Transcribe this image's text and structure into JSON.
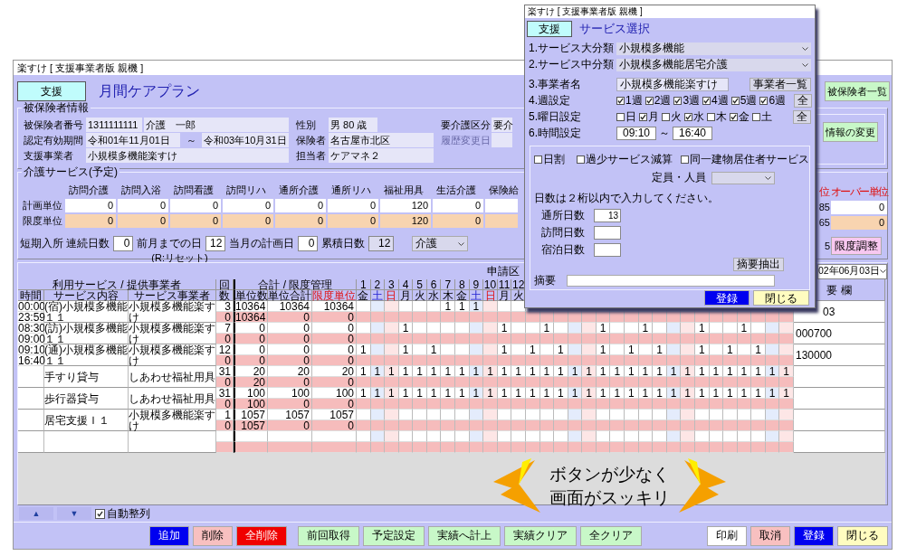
{
  "window": {
    "title": "楽すけ [ 支援事業者版 親機 ]"
  },
  "header": {
    "badge": "支援",
    "title": "月間ケアプラン",
    "list_button": "被保険者一覧"
  },
  "insured": {
    "legend": "被保険者情報",
    "change_button": "情報の変更",
    "rows": [
      {
        "items": [
          {
            "kind": "label",
            "text": "被保険者番号"
          },
          {
            "kind": "field",
            "text": "1311111111"
          },
          {
            "kind": "field",
            "text": "介護　一郎"
          },
          {
            "kind": "label",
            "text": "性別"
          },
          {
            "kind": "field",
            "text": "男 80 歳"
          },
          {
            "kind": "label",
            "text": "要介護区分"
          },
          {
            "kind": "field",
            "text": "要介"
          }
        ]
      },
      {
        "items": [
          {
            "kind": "label",
            "text": "認定有効期間"
          },
          {
            "kind": "field",
            "text": "令和01年11月01日"
          },
          {
            "kind": "tilde",
            "text": "～"
          },
          {
            "kind": "field",
            "text": "令和03年10月31日"
          },
          {
            "kind": "label",
            "text": "保険者"
          },
          {
            "kind": "field",
            "text": "名古屋市北区"
          },
          {
            "kind": "label",
            "text": "履歴変更日",
            "disabled": true
          },
          {
            "kind": "field"
          }
        ]
      },
      {
        "items": [
          {
            "kind": "label",
            "text": "支援事業者"
          },
          {
            "kind": "field",
            "text": "小規模多機能楽すけ"
          },
          {
            "kind": "label",
            "text": "担当者"
          },
          {
            "kind": "field",
            "text": "ケアマネ２"
          }
        ]
      }
    ]
  },
  "services": {
    "legend": "介護サービス(予定)",
    "categories": [
      "訪問介護",
      "訪問入浴",
      "訪問看護",
      "訪問リハ",
      "通所介護",
      "通所リハ",
      "福祉用具",
      "生活介護",
      "保険給"
    ],
    "rows": [
      {
        "label": "計画単位",
        "kind": "plan",
        "values": [
          "0",
          "0",
          "0",
          "0",
          "0",
          "0",
          "120",
          "0"
        ]
      },
      {
        "label": "限度単位",
        "kind": "limit",
        "values": [
          "0",
          "0",
          "0",
          "0",
          "0",
          "0",
          "120",
          "0"
        ]
      }
    ],
    "right_headers": [
      "位",
      "オーバー単位"
    ],
    "right_rows": [
      [
        "85",
        "0"
      ],
      [
        "65",
        "0"
      ]
    ],
    "right_extra": "5",
    "adjust_button": "限度調整",
    "short_stay": [
      {
        "label": "短期入所 連続日数",
        "value": "0"
      },
      {
        "label": "前月までの日",
        "value": "12",
        "note": "(R:リセット)"
      },
      {
        "label": "当月の計画日",
        "value": "0"
      },
      {
        "label": "累積日数",
        "value": "12",
        "readonly": true
      }
    ],
    "type_select": "介護"
  },
  "grid": {
    "apply_label": "申請区",
    "date_select": "02年06月03日",
    "group_headers": [
      "利用サービス / 提供事業者",
      "回",
      "合計 / 限度管理"
    ],
    "headers": [
      "時間",
      "サービス内容",
      "サービス事業者",
      "数",
      "単位数",
      "単位合計",
      "限度単位"
    ],
    "memo_header": "要 欄",
    "days": [
      {
        "num": "1",
        "weekday": "金",
        "kind": "weekday"
      },
      {
        "num": "2",
        "weekday": "土",
        "kind": "saturday"
      },
      {
        "num": "3",
        "weekday": "日",
        "kind": "sunday"
      },
      {
        "num": "4",
        "weekday": "月",
        "kind": "weekday"
      },
      {
        "num": "5",
        "weekday": "火",
        "kind": "weekday"
      },
      {
        "num": "6",
        "weekday": "水",
        "kind": "weekday"
      },
      {
        "num": "7",
        "weekday": "木",
        "kind": "weekday"
      },
      {
        "num": "8",
        "weekday": "金",
        "kind": "weekday"
      },
      {
        "num": "9",
        "weekday": "土",
        "kind": "saturday"
      },
      {
        "num": "10",
        "weekday": "日",
        "kind": "sunday"
      },
      {
        "num": "11",
        "weekday": "月",
        "kind": "weekday"
      },
      {
        "num": "12",
        "weekday": "火",
        "kind": "weekday"
      }
    ],
    "rows": [
      {
        "times": [
          "00:00",
          "23:59"
        ],
        "service": "(宿)小規模多機能１１",
        "provider": "小規模多機能楽すけ",
        "counts": [
          "3",
          "0"
        ],
        "units": [
          [
            "10364",
            "10364",
            "10364"
          ],
          [
            "10364",
            "0",
            "0"
          ]
        ],
        "memo": "03",
        "cells": [
          {},
          {},
          {},
          {},
          {},
          {},
          {
            "value": "1"
          },
          {
            "value": "1"
          },
          {
            "value": "1"
          },
          {},
          {},
          {},
          {},
          {},
          {},
          {},
          {},
          {},
          {},
          {},
          {},
          {},
          {},
          {},
          {},
          {},
          {},
          {},
          {},
          {},
          {}
        ]
      },
      {
        "times": [
          "08:30",
          "09:00"
        ],
        "service": "(訪)小規模多機能１１",
        "provider": "小規模多機能楽すけ",
        "counts": [
          "7",
          "0"
        ],
        "units": [
          [
            "0",
            "0",
            "0"
          ],
          [
            "0",
            "0",
            "0"
          ]
        ],
        "memo": "000700",
        "cells": [
          {},
          {},
          {},
          {
            "value": "1"
          },
          {},
          {},
          {},
          {},
          {},
          {},
          {
            "value": "1"
          },
          {},
          {},
          {
            "value": "1"
          },
          {},
          {},
          {},
          {
            "value": "1"
          },
          {},
          {},
          {
            "value": "1"
          },
          {},
          {},
          {},
          {
            "value": "1"
          },
          {},
          {},
          {
            "value": "1"
          },
          {},
          {},
          {}
        ]
      },
      {
        "times": [
          "09:10",
          "16:40"
        ],
        "service": "(通)小規模多機能１１",
        "provider": "小規模多機能楽すけ",
        "counts": [
          "12",
          "0"
        ],
        "units": [
          [
            "0",
            "0",
            "0"
          ],
          [
            "0",
            "0",
            "0"
          ]
        ],
        "memo": "130000",
        "cells": [
          {
            "value": "1"
          },
          {},
          {},
          {
            "value": "1"
          },
          {},
          {
            "value": "1"
          },
          {},
          {},
          {},
          {},
          {
            "value": "1"
          },
          {},
          {
            "value": "1"
          },
          {},
          {
            "value": "1"
          },
          {},
          {},
          {
            "value": "1"
          },
          {},
          {
            "value": "1"
          },
          {},
          {
            "value": "1"
          },
          {},
          {},
          {
            "value": "1"
          },
          {},
          {
            "value": "1"
          },
          {},
          {
            "value": "1"
          },
          {},
          {}
        ]
      },
      {
        "service": "手すり貸与",
        "provider": "しあわせ福祉用具",
        "counts": [
          "31",
          "0"
        ],
        "units": [
          [
            "20",
            "20",
            "20"
          ],
          [
            "20",
            "0",
            "0"
          ]
        ],
        "cells": [
          {
            "value": "1"
          },
          {
            "value": "1"
          },
          {
            "value": "1"
          },
          {
            "value": "1"
          },
          {
            "value": "1"
          },
          {
            "value": "1"
          },
          {
            "value": "1"
          },
          {
            "value": "1"
          },
          {
            "value": "1"
          },
          {
            "value": "1"
          },
          {
            "value": "1"
          },
          {
            "value": "1"
          },
          {
            "value": "1"
          },
          {
            "value": "1"
          },
          {
            "value": "1"
          },
          {
            "value": "1"
          },
          {
            "value": "1"
          },
          {
            "value": "1"
          },
          {
            "value": "1"
          },
          {
            "value": "1"
          },
          {
            "value": "1"
          },
          {
            "value": "1"
          },
          {
            "value": "1"
          },
          {
            "value": "1"
          },
          {
            "value": "1"
          },
          {
            "value": "1"
          },
          {
            "value": "1"
          },
          {
            "value": "1"
          },
          {
            "value": "1"
          },
          {
            "value": "1"
          },
          {
            "value": "1"
          }
        ]
      },
      {
        "service": "歩行器貸与",
        "provider": "しあわせ福祉用具",
        "counts": [
          "31",
          "0"
        ],
        "units": [
          [
            "100",
            "100",
            "100"
          ],
          [
            "100",
            "0",
            "0"
          ]
        ],
        "cells": [
          {
            "value": "1"
          },
          {
            "value": "1"
          },
          {
            "value": "1"
          },
          {
            "value": "1"
          },
          {
            "value": "1"
          },
          {
            "value": "1"
          },
          {
            "value": "1"
          },
          {
            "value": "1"
          },
          {
            "value": "1"
          },
          {
            "value": "1"
          },
          {
            "value": "1"
          },
          {
            "value": "1"
          },
          {
            "value": "1"
          },
          {
            "value": "1"
          },
          {
            "value": "1"
          },
          {
            "value": "1"
          },
          {
            "value": "1"
          },
          {
            "value": "1"
          },
          {
            "value": "1"
          },
          {
            "value": "1"
          },
          {
            "value": "1"
          },
          {
            "value": "1"
          },
          {
            "value": "1"
          },
          {
            "value": "1"
          },
          {
            "value": "1"
          },
          {
            "value": "1"
          },
          {
            "value": "1"
          },
          {
            "value": "1"
          },
          {
            "value": "1"
          },
          {
            "value": "1"
          },
          {
            "value": "1"
          }
        ]
      },
      {
        "service": "居宅支援Ｉ１",
        "provider": "小規模多機能楽すけ",
        "counts": [
          "1",
          "0"
        ],
        "units": [
          [
            "1057",
            "1057",
            "1057"
          ],
          [
            "1057",
            "0",
            "0"
          ]
        ]
      },
      {}
    ]
  },
  "callout": {
    "lines": [
      "ボタンが少なく",
      "画面がスッキリ"
    ]
  },
  "nav": {
    "up": "▲",
    "down": "▼",
    "auto_sort": {
      "label": "自動整列",
      "checked": true
    }
  },
  "buttons_left": [
    {
      "label": "追加",
      "kind": "primary"
    },
    {
      "label": "削除",
      "kind": "soft-danger"
    },
    {
      "label": "全削除",
      "kind": "danger"
    },
    {
      "label": "前回取得",
      "kind": "action"
    },
    {
      "label": "予定設定",
      "kind": "action"
    },
    {
      "label": "実績へ計上",
      "kind": "action"
    },
    {
      "label": "実績クリア",
      "kind": "action"
    },
    {
      "label": "全クリア",
      "kind": "action"
    }
  ],
  "buttons_right": [
    {
      "label": "印刷",
      "kind": "plain"
    },
    {
      "label": "取消",
      "kind": "soft-danger"
    },
    {
      "label": "登録",
      "kind": "primary"
    },
    {
      "label": "閉じる",
      "kind": "close"
    }
  ],
  "dialog": {
    "title": "楽すけ [ 支援事業者版 親機 ]",
    "badge": "支援",
    "heading": "サービス選択",
    "selects": [
      {
        "label": "1.サービス大分類",
        "value": "小規模多機能"
      },
      {
        "label": "2.サービス中分類",
        "value": "小規模多機能居宅介護"
      }
    ],
    "provider": {
      "label": "3.事業者名",
      "value": "小規模多機能楽すけ",
      "button": "事業者一覧"
    },
    "weeks": {
      "label": "4.週設定",
      "button": "全",
      "items": [
        {
          "label": "1週",
          "checked": true
        },
        {
          "label": "2週",
          "checked": true
        },
        {
          "label": "3週",
          "checked": true
        },
        {
          "label": "4週",
          "checked": true
        },
        {
          "label": "5週",
          "checked": true
        },
        {
          "label": "6週",
          "checked": true
        }
      ]
    },
    "weekdays": {
      "label": "5.曜日設定",
      "button": "全",
      "items": [
        {
          "label": "日",
          "checked": false
        },
        {
          "label": "月",
          "checked": true
        },
        {
          "label": "火",
          "checked": false
        },
        {
          "label": "水",
          "checked": true
        },
        {
          "label": "木",
          "checked": false
        },
        {
          "label": "金",
          "checked": true
        },
        {
          "label": "土",
          "checked": false
        }
      ]
    },
    "time": {
      "label": "6.時間設定",
      "from": "09:10",
      "sep": "～",
      "to": "16:40"
    },
    "options": [
      {
        "label": "日割",
        "checked": false
      },
      {
        "label": "過少サービス減算",
        "checked": false
      },
      {
        "label": "同一建物居住者サービス",
        "checked": false
      }
    ],
    "capacity_label": "定員・人員",
    "note": "日数は２桁以内で入力してください。",
    "day_counts": [
      {
        "label": "通所日数",
        "value": "13"
      },
      {
        "label": "訪問日数"
      },
      {
        "label": "宿泊日数"
      }
    ],
    "extract_button": "摘要抽出",
    "summary_label": "摘要",
    "buttons": [
      {
        "label": "登録",
        "kind": "primary"
      },
      {
        "label": "閉じる",
        "kind": "close"
      }
    ]
  }
}
